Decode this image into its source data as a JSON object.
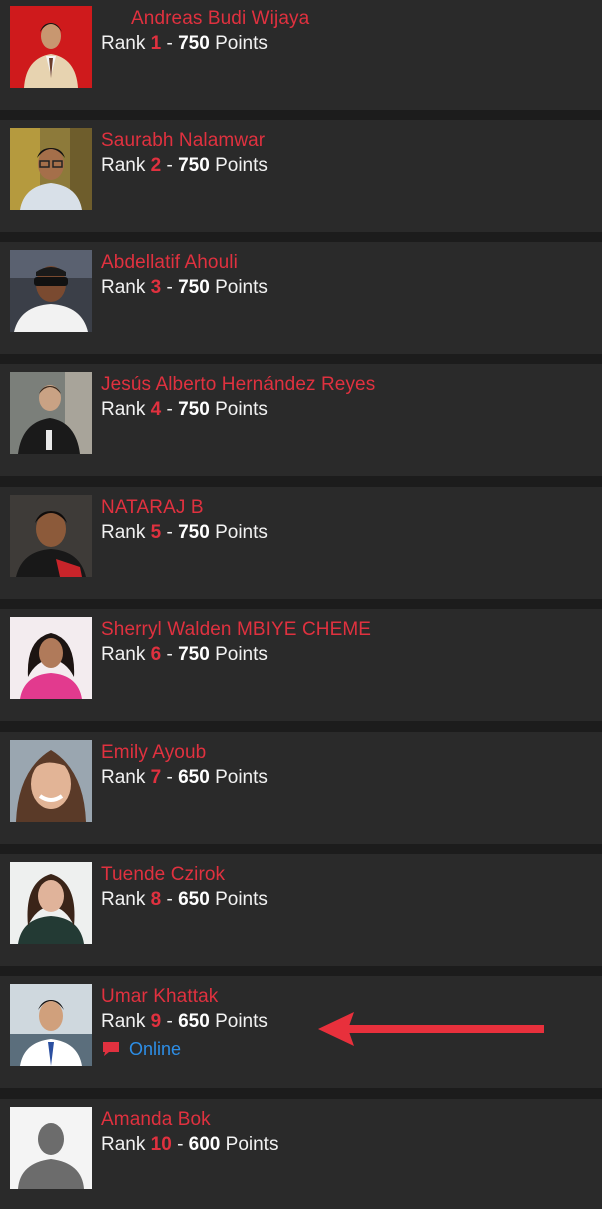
{
  "members": [
    {
      "name": "Andreas Budi Wijaya",
      "rank_label": "Rank",
      "rank": "1",
      "separator": "-",
      "points": "750",
      "points_label": "Points"
    },
    {
      "name": "Saurabh Nalamwar",
      "rank_label": "Rank",
      "rank": "2",
      "separator": "-",
      "points": "750",
      "points_label": "Points"
    },
    {
      "name": "Abdellatif Ahouli",
      "rank_label": "Rank",
      "rank": "3",
      "separator": "-",
      "points": "750",
      "points_label": "Points"
    },
    {
      "name": "Jesús Alberto Hernández Reyes",
      "rank_label": "Rank",
      "rank": "4",
      "separator": "-",
      "points": "750",
      "points_label": "Points"
    },
    {
      "name": "NATARAJ B",
      "rank_label": "Rank",
      "rank": "5",
      "separator": "-",
      "points": "750",
      "points_label": "Points"
    },
    {
      "name": "Sherryl Walden MBIYE CHEME",
      "rank_label": "Rank",
      "rank": "6",
      "separator": "-",
      "points": "750",
      "points_label": "Points"
    },
    {
      "name": "Emily Ayoub",
      "rank_label": "Rank",
      "rank": "7",
      "separator": "-",
      "points": "650",
      "points_label": "Points"
    },
    {
      "name": "Tuende Czirok",
      "rank_label": "Rank",
      "rank": "8",
      "separator": "-",
      "points": "650",
      "points_label": "Points"
    },
    {
      "name": "Umar Khattak",
      "rank_label": "Rank",
      "rank": "9",
      "separator": "-",
      "points": "650",
      "points_label": "Points",
      "status": "Online"
    },
    {
      "name": "Amanda Bok",
      "rank_label": "Rank",
      "rank": "10",
      "separator": "-",
      "points": "600",
      "points_label": "Points"
    }
  ],
  "colors": {
    "background": "#1c1c1c",
    "row": "#2a2a2a",
    "accent_red": "#e0313f",
    "online_blue": "#2d8ee6",
    "arrow_red": "#e8303c"
  },
  "icons": {
    "chat": "chat-bubble-icon",
    "arrow": "left-arrow-annotation",
    "placeholder_avatar": "person-silhouette-icon"
  }
}
